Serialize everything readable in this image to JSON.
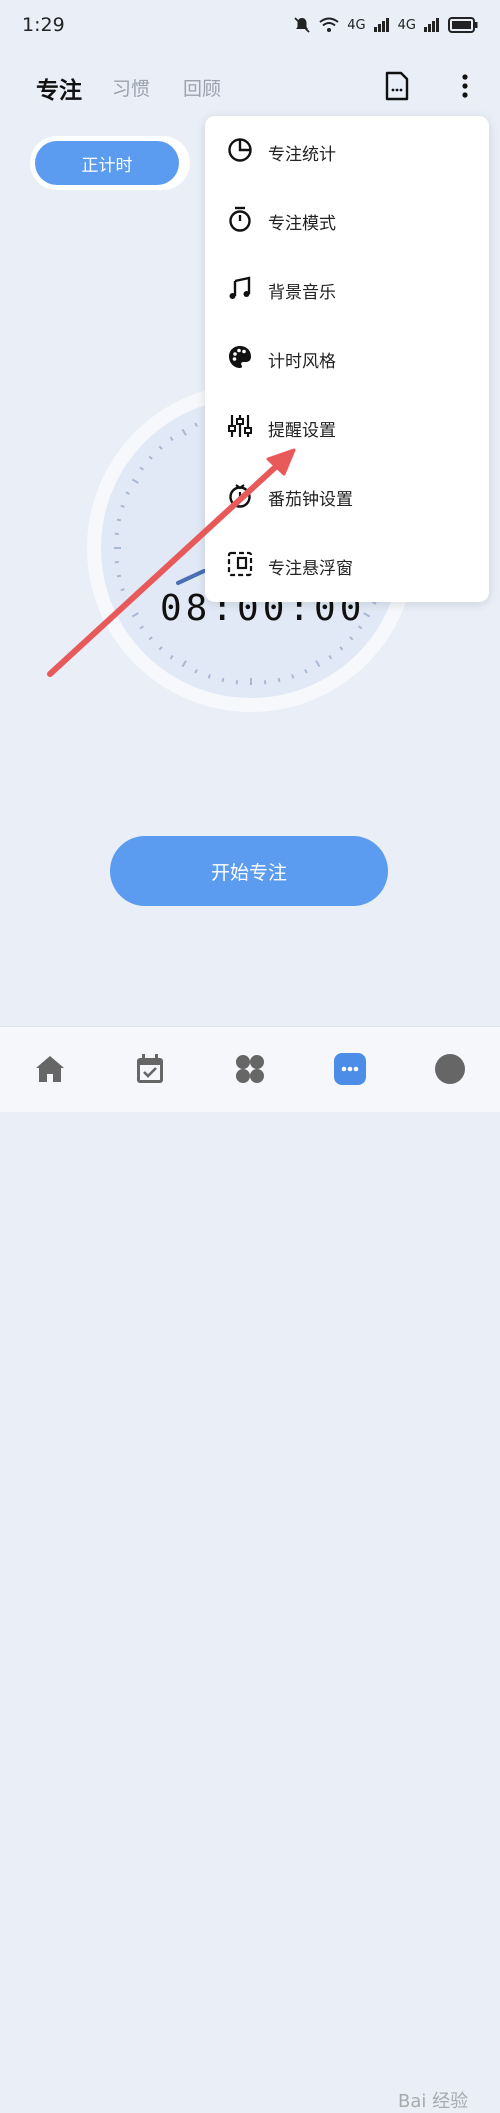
{
  "status_bar": {
    "time": "1:29",
    "net1": "4G",
    "net2": "4G"
  },
  "header": {
    "tabs": [
      {
        "label": "专注",
        "active": true
      },
      {
        "label": "习惯",
        "active": false
      },
      {
        "label": "回顾",
        "active": false
      }
    ]
  },
  "mode": {
    "active_label": "正计时"
  },
  "timer": {
    "display": "08:00:00"
  },
  "start_button": {
    "label": "开始专注"
  },
  "menu": {
    "items": [
      {
        "label": "专注统计",
        "icon": "pie-chart-icon"
      },
      {
        "label": "专注模式",
        "icon": "stopwatch-icon"
      },
      {
        "label": "背景音乐",
        "icon": "music-note-icon"
      },
      {
        "label": "计时风格",
        "icon": "palette-icon"
      },
      {
        "label": "提醒设置",
        "icon": "sliders-icon"
      },
      {
        "label": "番茄钟设置",
        "icon": "tomato-timer-icon"
      },
      {
        "label": "专注悬浮窗",
        "icon": "floating-window-icon"
      }
    ]
  },
  "bottom_nav": {
    "items": [
      "home-icon",
      "calendar-check-icon",
      "apps-grid-icon",
      "focus-icon",
      "profile-icon"
    ]
  },
  "watermark": "Bai 经验",
  "colors": {
    "accent": "#5b9cf0",
    "background": "#e9eef7",
    "arrow": "#e85a5a"
  }
}
